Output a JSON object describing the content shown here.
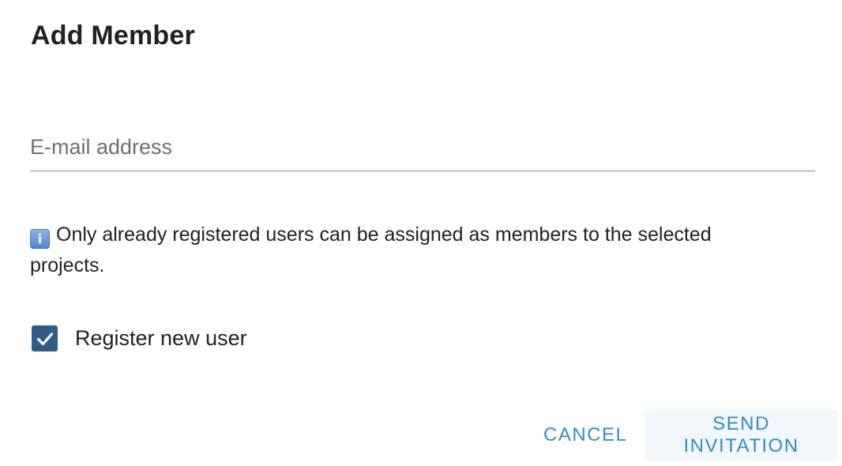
{
  "dialog": {
    "title": "Add Member",
    "email_field": {
      "placeholder": "E-mail address",
      "value": ""
    },
    "info": {
      "icon": "info-icon",
      "icon_glyph": "i",
      "text": "Only already registered users can be assigned as members to the selected projects."
    },
    "register_checkbox": {
      "label": "Register new user",
      "checked": true
    },
    "actions": {
      "cancel_label": "CANCEL",
      "send_label": "SEND INVITATION"
    }
  },
  "colors": {
    "accent": "#2f8dc4",
    "checkbox_fill": "#2f5d84",
    "send_button_bg": "#f2f7fb"
  }
}
